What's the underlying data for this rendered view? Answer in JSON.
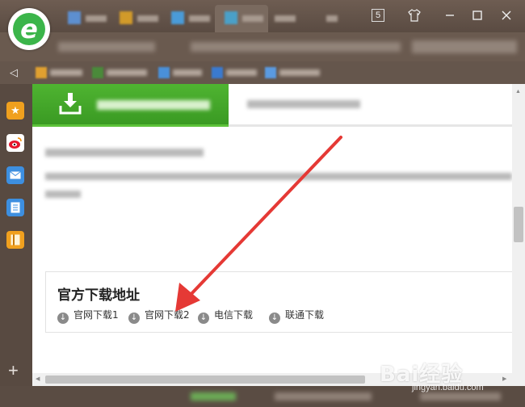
{
  "titlebar": {
    "badge": "5",
    "controls": [
      "shirt-icon",
      "minimize-icon",
      "maximize-icon",
      "close-icon"
    ]
  },
  "colors": {
    "accent_green": "#3bb54a",
    "frame": "#5d5048",
    "annotation_red": "#e53935"
  },
  "main": {
    "download_section": {
      "title": "官方下载地址",
      "links": [
        "官网下载1",
        "官网下载2",
        "电信下载",
        "联通下载"
      ]
    }
  },
  "watermark": {
    "brand": "Bai经验",
    "url": "jingyan.baidu.com"
  }
}
